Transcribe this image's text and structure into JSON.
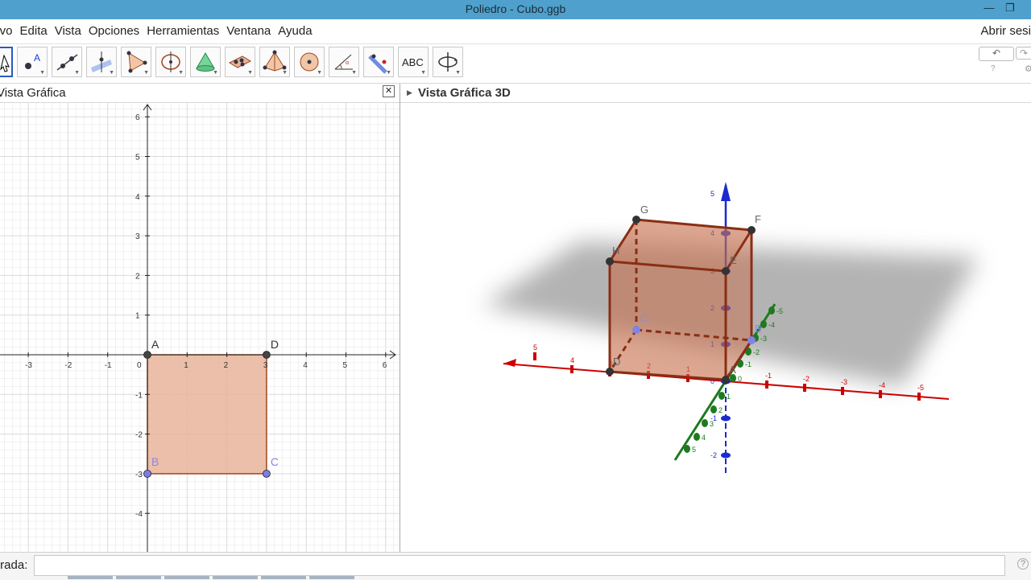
{
  "window": {
    "title": "Poliedro - Cubo.ggb"
  },
  "menu": {
    "items": [
      "hivo",
      "Edita",
      "Vista",
      "Opciones",
      "Herramientas",
      "Ventana",
      "Ayuda"
    ],
    "signin": "Abrir sesi"
  },
  "toolbar": {
    "tools": [
      "move-tool-icon",
      "point-tool-icon",
      "line-tool-icon",
      "perpendicular-tool-icon",
      "polygon-tool-icon",
      "circle-axis-tool-icon",
      "cone-tool-icon",
      "plane-tool-icon",
      "pyramid-tool-icon",
      "sphere-tool-icon",
      "angle-tool-icon",
      "reflect-tool-icon",
      "text-tool-icon",
      "rotate-view-tool-icon"
    ],
    "text_tool_label": "ABC",
    "undo_icon": "undo-icon",
    "redo_icon": "redo-icon"
  },
  "graphics2d": {
    "title": "Vista Gráfica",
    "x_ticks": [
      "-3",
      "-2",
      "-1",
      "0",
      "1",
      "2",
      "3",
      "4",
      "5",
      "6"
    ],
    "y_ticks": [
      "6",
      "5",
      "4",
      "3",
      "2",
      "1",
      "-1",
      "-2",
      "-3",
      "-4"
    ],
    "points": [
      {
        "label": "A",
        "x": 0,
        "y": 0,
        "color": "#444444"
      },
      {
        "label": "D",
        "x": 3,
        "y": 0,
        "color": "#444444"
      },
      {
        "label": "B",
        "x": 0,
        "y": -3,
        "color": "#7d7de8"
      },
      {
        "label": "C",
        "x": 3,
        "y": -3,
        "color": "#7d7de8"
      }
    ],
    "square_fill": "#e8b49a",
    "square_stroke": "#a2441f"
  },
  "graphics3d": {
    "title": "Vista Gráfica 3D",
    "vertex_labels": [
      "G",
      "F",
      "H",
      "E",
      "C",
      "B",
      "D",
      "A"
    ],
    "axis_colors": {
      "x": "#cc0000",
      "y": "#1e7a1e",
      "z": "#1a2bd0"
    },
    "x_tick_labels": [
      "5",
      "4",
      "3",
      "2",
      "1",
      "-1",
      "-2",
      "-3",
      "-4",
      "-5"
    ],
    "y_tick_labels": [
      "-5",
      "-4",
      "-3",
      "-2",
      "-1",
      "0",
      "1",
      "2",
      "3",
      "4",
      "5"
    ],
    "z_tick_labels": [
      "5",
      "4",
      "3",
      "2",
      "1",
      "0",
      "-1",
      "-2"
    ]
  },
  "input": {
    "label": "trada:"
  }
}
